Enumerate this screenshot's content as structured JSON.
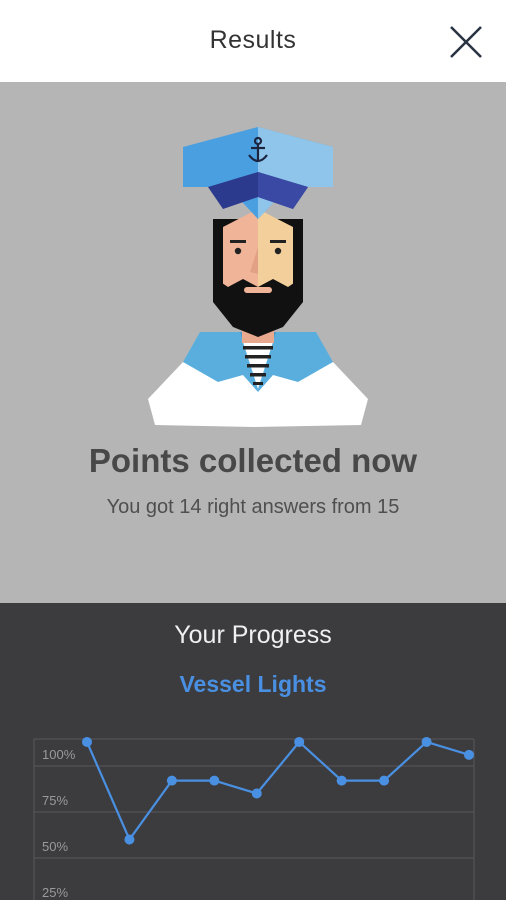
{
  "header": {
    "title": "Results",
    "close_icon": "close-icon"
  },
  "result": {
    "avatar_icon": "sailor-avatar",
    "heading": "Points collected now",
    "summary": "You got 14 right answers from 15"
  },
  "progress": {
    "title": "Your Progress",
    "topic": "Vessel Lights"
  },
  "chart_data": {
    "type": "line",
    "title": "",
    "xlabel": "",
    "ylabel": "",
    "y_ticks": [
      "100%",
      "75%",
      "50%",
      "25%"
    ],
    "y_tick_values": [
      100,
      75,
      50,
      25
    ],
    "ylim": [
      0,
      106
    ],
    "grid": true,
    "series": [
      {
        "values": [
          106,
          53,
          85,
          85,
          78,
          106,
          85,
          85,
          106,
          99
        ]
      }
    ],
    "colors": {
      "line": "#4a90e2",
      "grid": "#58585c",
      "tick": "#9a9a9a"
    }
  }
}
